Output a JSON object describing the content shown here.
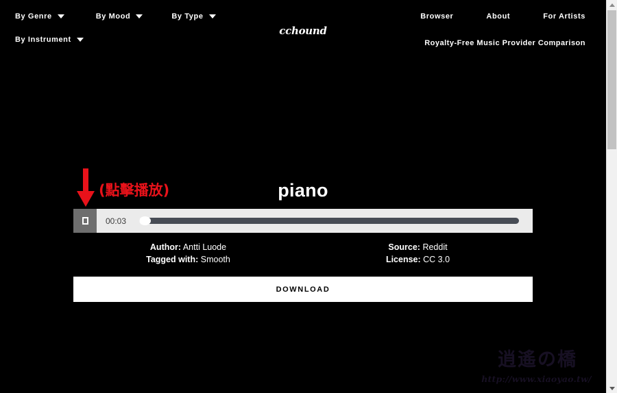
{
  "site": {
    "logo": "cchound",
    "background_color": "#000000"
  },
  "nav": {
    "left_items": [
      {
        "label": "By Genre",
        "has_caret": true
      },
      {
        "label": "By Mood",
        "has_caret": true
      },
      {
        "label": "By Type",
        "has_caret": true
      },
      {
        "label": "By Instrument",
        "has_caret": true
      }
    ],
    "right_items": [
      {
        "label": "Browser"
      },
      {
        "label": "About"
      },
      {
        "label": "For Artists"
      }
    ],
    "right_secondary": "Royalty-Free Music Provider Comparison"
  },
  "annotation": {
    "text": "(點擊播放)",
    "color": "#e8121a",
    "arrow_icon": "red-down-arrow-icon"
  },
  "track": {
    "title": "piano",
    "player": {
      "button_icon": "stop-icon",
      "time": "00:03",
      "progress_percent": 0
    },
    "meta_left": [
      {
        "key": "Author:",
        "value": "Antti Luode"
      },
      {
        "key": "Tagged with:",
        "value": "Smooth"
      }
    ],
    "meta_right": [
      {
        "key": "Source:",
        "value": "Reddit"
      },
      {
        "key": "License:",
        "value": "CC 3.0"
      }
    ],
    "download_label": "DOWNLOAD"
  },
  "watermark": {
    "glyph": "逍遙の橋",
    "url": "http://www.xiaoyao.tw/"
  },
  "scrollbar": {
    "up_icon": "scroll-up-arrow-icon",
    "down_icon": "scroll-down-arrow-icon"
  }
}
